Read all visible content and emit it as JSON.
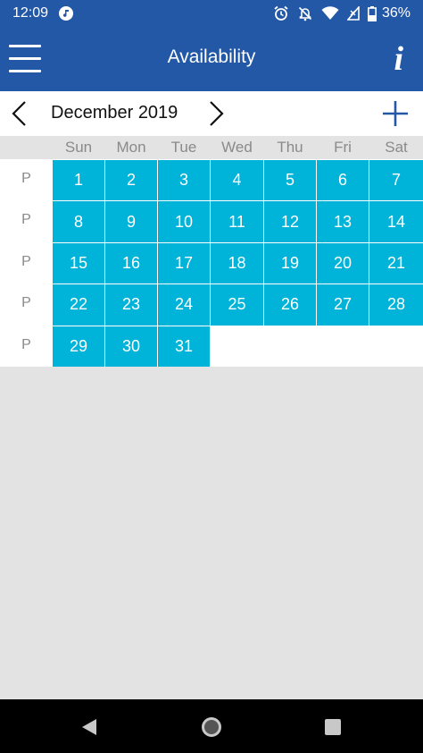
{
  "status_bar": {
    "time": "12:09",
    "battery": "36%",
    "icons": [
      "music-note-icon",
      "alarm-icon",
      "notifications-off-icon",
      "wifi-icon",
      "signal-icon",
      "battery-icon"
    ]
  },
  "app_bar": {
    "title": "Availability",
    "info_glyph": "i"
  },
  "month_nav": {
    "label": "December 2019"
  },
  "weekdays": [
    "Sun",
    "Mon",
    "Tue",
    "Wed",
    "Thu",
    "Fri",
    "Sat"
  ],
  "weeks": [
    {
      "label": "P",
      "days": [
        "1",
        "2",
        "3",
        "4",
        "5",
        "6",
        "7"
      ]
    },
    {
      "label": "P",
      "days": [
        "8",
        "9",
        "10",
        "11",
        "12",
        "13",
        "14"
      ]
    },
    {
      "label": "P",
      "days": [
        "15",
        "16",
        "17",
        "18",
        "19",
        "20",
        "21"
      ]
    },
    {
      "label": "P",
      "days": [
        "22",
        "23",
        "24",
        "25",
        "26",
        "27",
        "28"
      ]
    },
    {
      "label": "P",
      "days": [
        "29",
        "30",
        "31",
        "",
        "",
        "",
        ""
      ]
    }
  ],
  "colors": {
    "primary": "#2358a6",
    "day_cell": "#00b3d9",
    "background": "#e3e3e3"
  }
}
